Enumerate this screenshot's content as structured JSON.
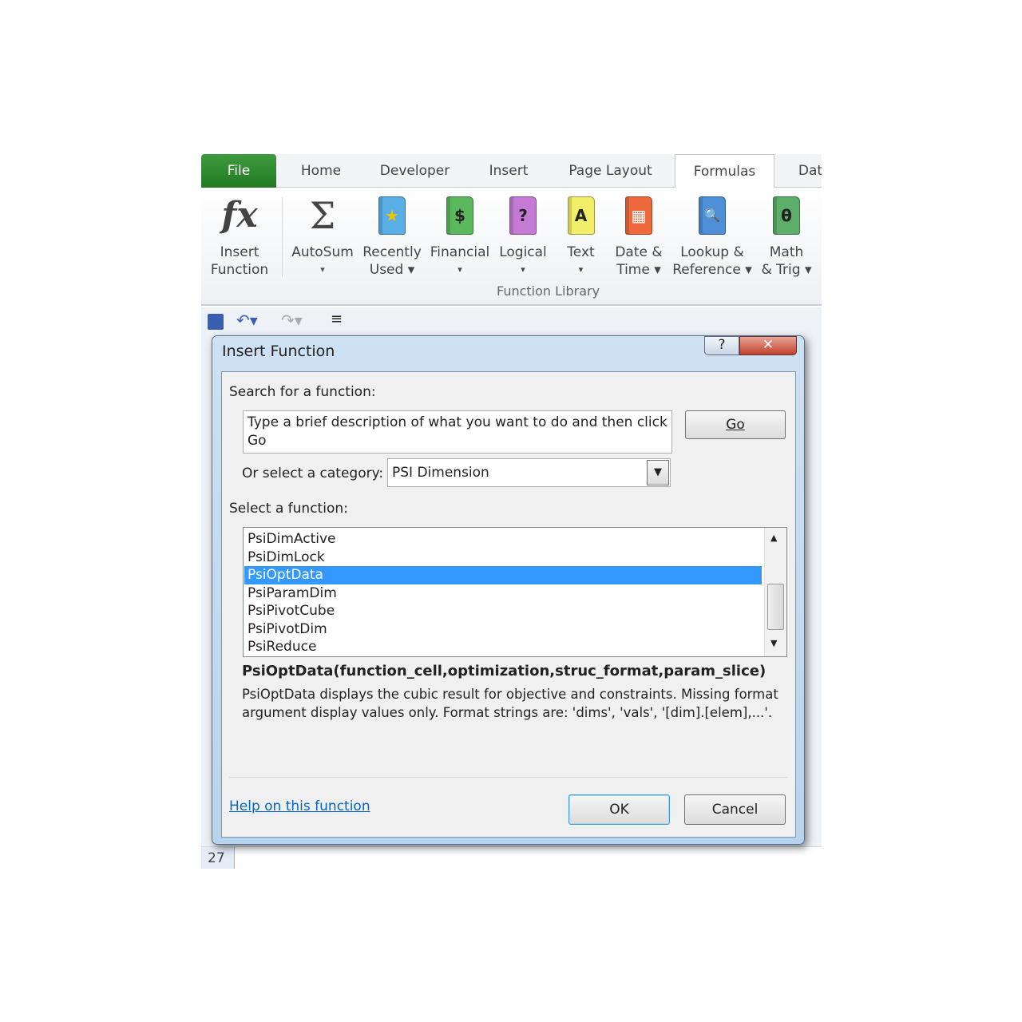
{
  "ribbon_tabs": [
    "File",
    "Home",
    "Developer",
    "Insert",
    "Page Layout",
    "Formulas",
    "Dat"
  ],
  "ribbon_buttons": [
    {
      "line1": "Insert",
      "line2": "Function",
      "icon": "fx-icon"
    },
    {
      "line1": "AutoSum",
      "line2": "▾",
      "icon": "sigma-icon"
    },
    {
      "line1": "Recently",
      "line2": "Used ▾",
      "icon": "book-star-icon",
      "color": "#5aaee6",
      "glyph": "★"
    },
    {
      "line1": "Financial",
      "line2": "▾",
      "icon": "book-money-icon",
      "color": "#5cb85c",
      "glyph": "$"
    },
    {
      "line1": "Logical",
      "line2": "▾",
      "icon": "book-question-icon",
      "color": "#c57bd6",
      "glyph": "?"
    },
    {
      "line1": "Text",
      "line2": "▾",
      "icon": "book-text-icon",
      "color": "#f2ee6a",
      "glyph": "A"
    },
    {
      "line1": "Date &",
      "line2": "Time ▾",
      "icon": "book-calendar-icon",
      "color": "#ee6a3c",
      "glyph": "▦"
    },
    {
      "line1": "Lookup &",
      "line2": "Reference ▾",
      "icon": "book-magnifier-icon",
      "color": "#4f8fd8",
      "glyph": "🔍"
    },
    {
      "line1": "Math",
      "line2": "& Trig ▾",
      "icon": "book-theta-icon",
      "color": "#5cae6a",
      "glyph": "θ"
    }
  ],
  "group_label": "Function Library",
  "row_number": "27",
  "dialog": {
    "title": "Insert Function",
    "help_btn": "?",
    "close_btn": "✕",
    "search_label": "Search for a function:",
    "search_value": "Type a brief description of what you want to do and then click Go",
    "go": "Go",
    "category_label": "Or select a category:",
    "category_value": "PSI Dimension",
    "select_label": "Select a function:",
    "functions": [
      "PsiDimActive",
      "PsiDimLock",
      "PsiOptData",
      "PsiParamDim",
      "PsiPivotCube",
      "PsiPivotDim",
      "PsiReduce"
    ],
    "selected": "PsiOptData",
    "signature": "PsiOptData(function_cell,optimization,struc_format,param_slice)",
    "description": "PsiOptData displays the cubic result for objective and constraints. Missing format argument display values only. Format strings are: 'dims', 'vals', '[dim].[elem],...'.",
    "help_link": "Help on this function",
    "ok": "OK",
    "cancel": "Cancel"
  }
}
